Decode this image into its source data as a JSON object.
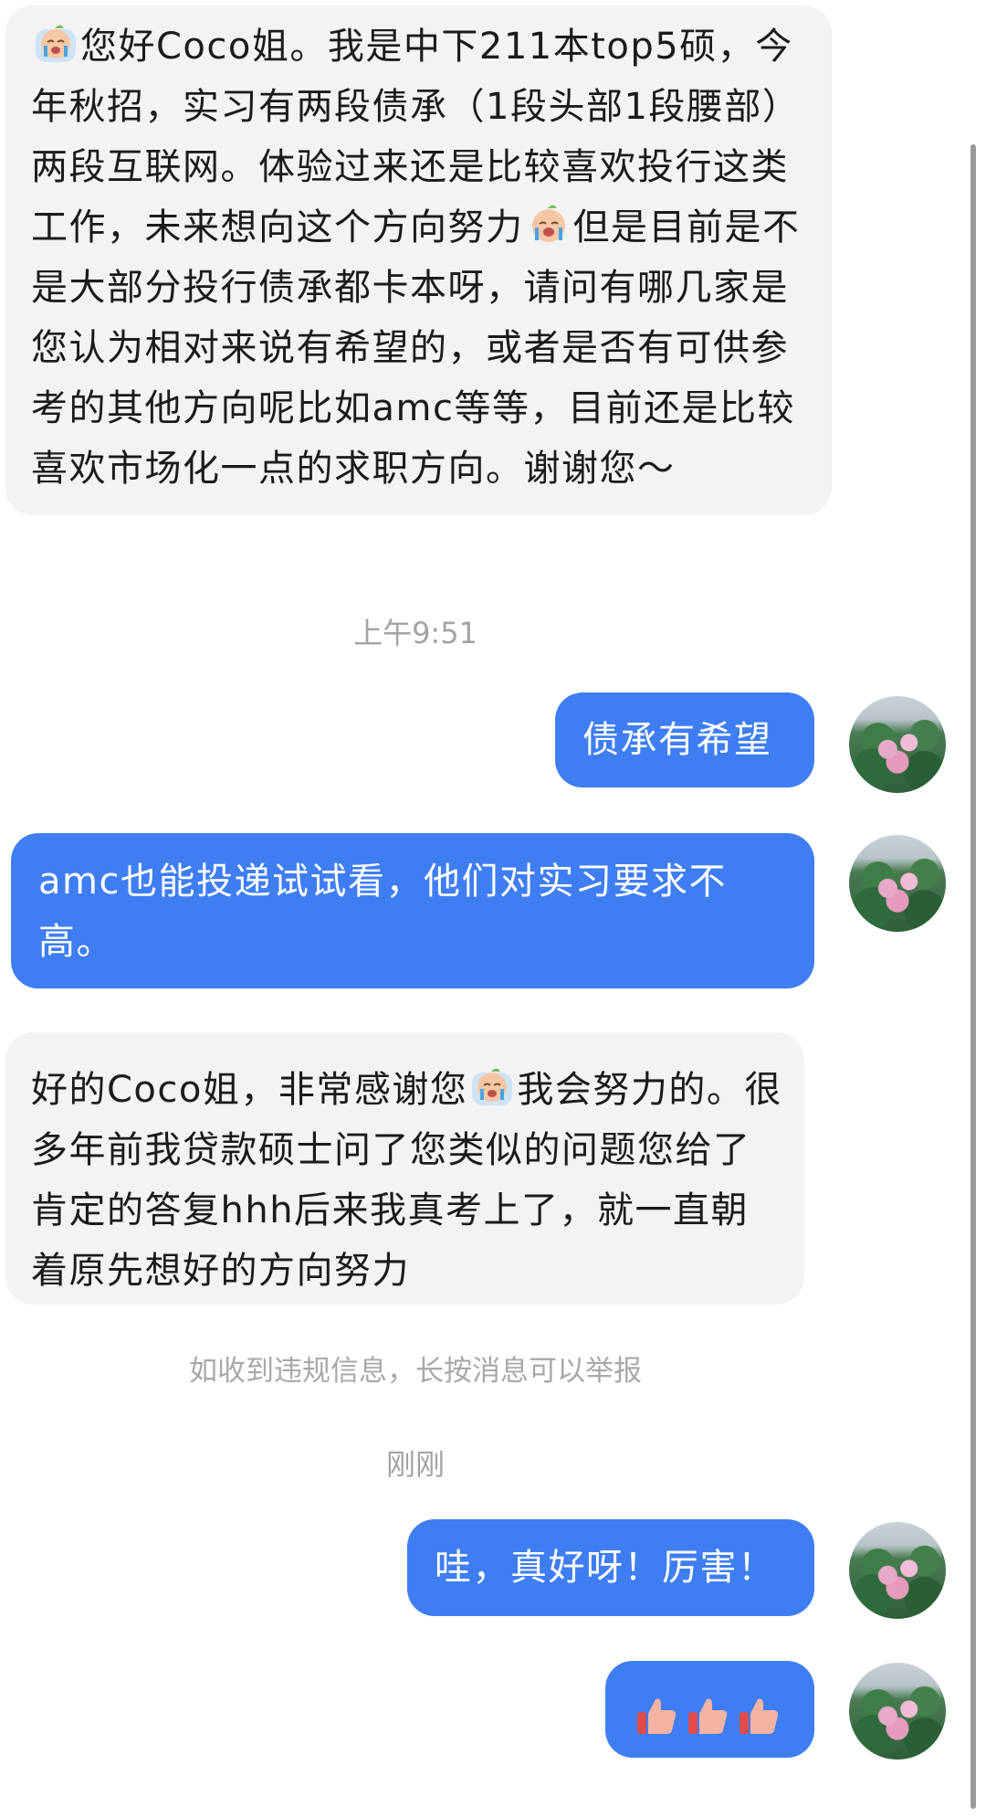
{
  "messages": {
    "m1": {
      "prefix_emoji": "crying-face-emoji",
      "part1": "您好Coco姐。我是中下211本top5硕，今年秋招，实习有两段债承（1段头部1段腰部）两段互联网。体验过来还是比较喜欢投行这类工作，未来想向这个方向努力",
      "mid_emoji": "crying-face-emoji",
      "part2": "但是目前是不是大部分投行债承都卡本呀，请问有哪几家是您认为相对来说有希望的，或者是否有可供参考的其他方向呢比如amc等等，目前还是比较喜欢市场化一点的求职方向。谢谢您～"
    },
    "time1": "上午9:51",
    "m2": {
      "text": "债承有希望"
    },
    "m3": {
      "text": "amc也能投递试试看，他们对实习要求不高。"
    },
    "m4": {
      "part1": "好的Coco姐，非常感谢您",
      "mid_emoji": "crying-face-emoji",
      "part2": "我会努力的。很多年前我贷款硕士问了您类似的问题您给了肯定的答复hhh后来我真考上了，就一直朝着原先想好的方向努力"
    },
    "notice": "如收到违规信息，长按消息可以举报",
    "time2": "刚刚",
    "m5": {
      "text": "哇，真好呀！厉害！"
    },
    "m6": {
      "emojis": [
        "thumbs-up-emoji",
        "thumbs-up-emoji",
        "thumbs-up-emoji"
      ]
    }
  },
  "colors": {
    "incoming_bubble": "#f3f3f3",
    "outgoing_bubble": "#3f7ef2",
    "timestamp_text": "#a3a3a3"
  },
  "avatar": {
    "icon": "lotus-pond-avatar"
  }
}
